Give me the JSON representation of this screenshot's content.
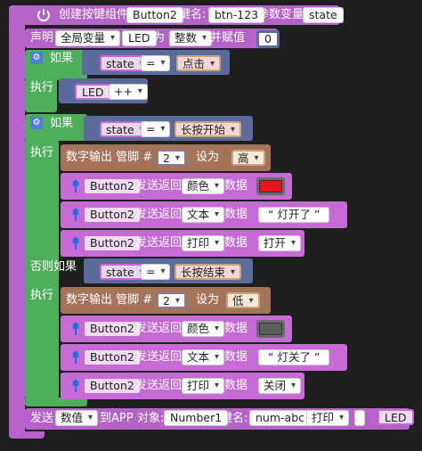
{
  "power_icon": "power-icon",
  "create": {
    "label": "创建按键组件",
    "component": "Button2",
    "key_label": "键名:",
    "key_value": "btn-123",
    "param_label": "参数变量",
    "param_value": "state"
  },
  "declare": {
    "label": "声明",
    "scope": "全局变量",
    "var": "LED",
    "as_label": "为",
    "type": "整数",
    "assign_label": "并赋值",
    "value": "0"
  },
  "if1": {
    "if_label": "如果",
    "var": "state",
    "op": "=",
    "value": "点击",
    "do_label": "执行",
    "inc_var": "LED",
    "inc_op": "++"
  },
  "if2": {
    "if_label": "如果",
    "var": "state",
    "op": "=",
    "value": "长按开始",
    "do_label": "执行",
    "elif_label": "否则如果",
    "elif_var": "state",
    "elif_op": "=",
    "elif_value": "长按结束",
    "do2_label": "执行"
  },
  "digital_write_1": {
    "label": "数字输出 管脚 #",
    "pin": "2",
    "set_label": "设为",
    "level": "高"
  },
  "digital_write_2": {
    "label": "数字输出 管脚 #",
    "pin": "2",
    "set_label": "设为",
    "level": "低"
  },
  "sends_on": [
    {
      "component": "Button2",
      "label": "发送返回",
      "type": "颜色",
      "data_label": "数据",
      "color": "#e8141b"
    },
    {
      "component": "Button2",
      "label": "发送返回",
      "type": "文本",
      "data_label": "数据",
      "text": "“ 灯开了 ”"
    },
    {
      "component": "Button2",
      "label": "发送返回",
      "type": "打印",
      "data_label": "数据",
      "value": "打开"
    }
  ],
  "sends_off": [
    {
      "component": "Button2",
      "label": "发送返回",
      "type": "颜色",
      "data_label": "数据",
      "color": "#5d5d5d"
    },
    {
      "component": "Button2",
      "label": "发送返回",
      "type": "文本",
      "data_label": "数据",
      "text": "“ 灯关了 ”"
    },
    {
      "component": "Button2",
      "label": "发送返回",
      "type": "打印",
      "data_label": "数据",
      "value": "关闭"
    }
  ],
  "send_app": {
    "label": "发送",
    "type": "数值",
    "to_label": "到APP",
    "obj_label": "对象:",
    "obj": "Number1",
    "key_label": "键名:",
    "key": "num-abc",
    "mode": "打印",
    "var": "LED"
  }
}
